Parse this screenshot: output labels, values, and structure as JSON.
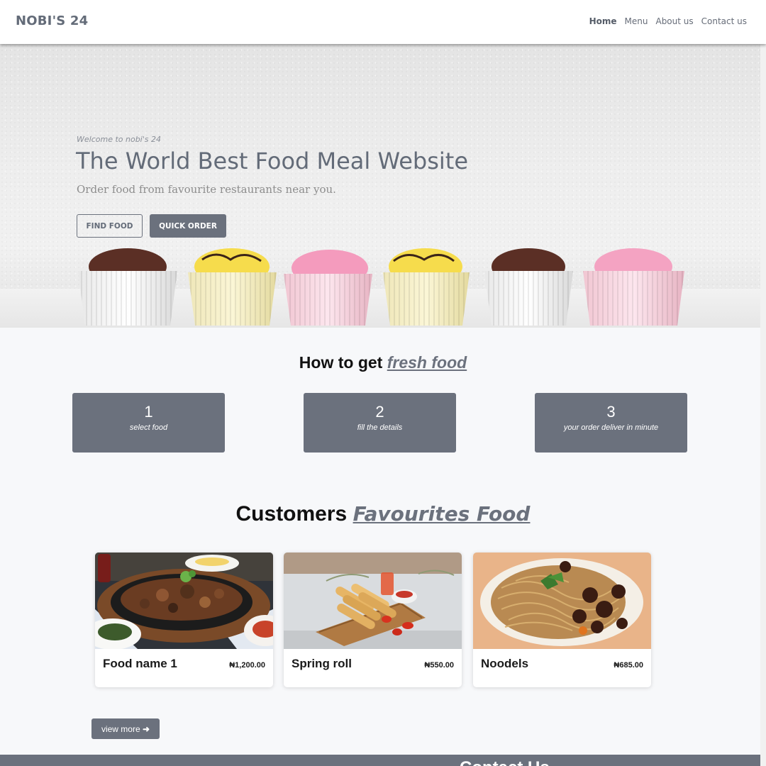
{
  "brand": "NOBI'S 24",
  "nav": {
    "items": [
      {
        "label": "Home",
        "active": true
      },
      {
        "label": "Menu",
        "active": false
      },
      {
        "label": "About us",
        "active": false
      },
      {
        "label": "Contact us",
        "active": false
      }
    ]
  },
  "hero": {
    "welcome": "Welcome to nobi's 24",
    "title": "The World Best Food Meal Website",
    "subtitle": "Order food from favourite restaurants near you.",
    "find_food_label": "FIND FOOD",
    "quick_order_label": "QUICK ORDER"
  },
  "steps_section": {
    "title_prefix": "How to get ",
    "title_highlight": "fresh food",
    "steps": [
      {
        "number": "1",
        "text": "select food"
      },
      {
        "number": "2",
        "text": "fill the details"
      },
      {
        "number": "3",
        "text": "your order deliver in minute"
      }
    ]
  },
  "favourites": {
    "title_prefix": "Customers ",
    "title_highlight": "Favourites Food",
    "items": [
      {
        "name": "Food name 1",
        "price": "₦1,200.00"
      },
      {
        "name": "Spring roll",
        "price": "₦550.00"
      },
      {
        "name": "Noodels",
        "price": "₦685.00"
      }
    ],
    "view_more_label": "view more"
  },
  "footer": {
    "contact_heading": "Contact Us"
  },
  "colors": {
    "accent": "#6b717d",
    "background": "#f7f8fa"
  }
}
